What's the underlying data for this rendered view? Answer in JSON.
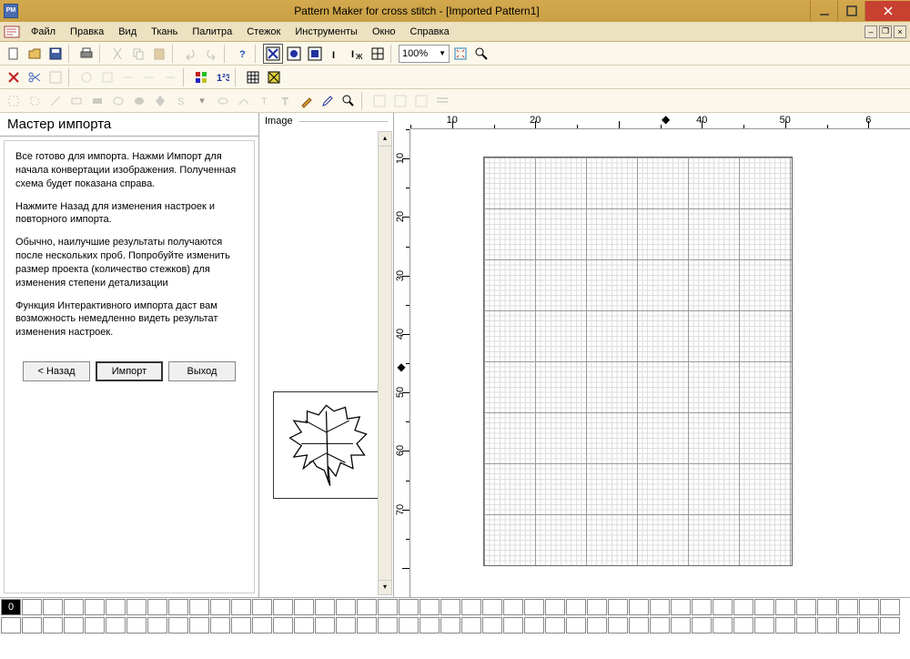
{
  "title": "Pattern Maker for cross stitch - [Imported Pattern1]",
  "app_icon_text": "PM",
  "menu": [
    "Файл",
    "Правка",
    "Вид",
    "Ткань",
    "Палитра",
    "Стежок",
    "Инструменты",
    "Окно",
    "Справка"
  ],
  "zoom": "100%",
  "wizard": {
    "title": "Мастер импорта",
    "p1": "Все готово для импорта.  Нажми Импорт для начала конвертации изображения.  Полученная схема будет показана справа.",
    "p2": "Нажмите Назад для изменения настроек и повторного импорта.",
    "p3": "Обычно, наилучшие результаты получаются после нескольких проб.  Попробуйте изменить размер проекта (количество стежков) для изменения степени детализации",
    "p4": "Функция Интерактивного импорта даст вам возможность немедленно видеть результат изменения настроек.",
    "back": "< Назад",
    "import": "Импорт",
    "exit": "Выход"
  },
  "image_panel_label": "Image",
  "ruler_h": [
    "10",
    "20",
    "",
    "40",
    "50",
    "6"
  ],
  "ruler_v": [
    "10",
    "20",
    "30",
    "40",
    "50",
    "60",
    "70",
    ""
  ],
  "palette_selected": "0"
}
